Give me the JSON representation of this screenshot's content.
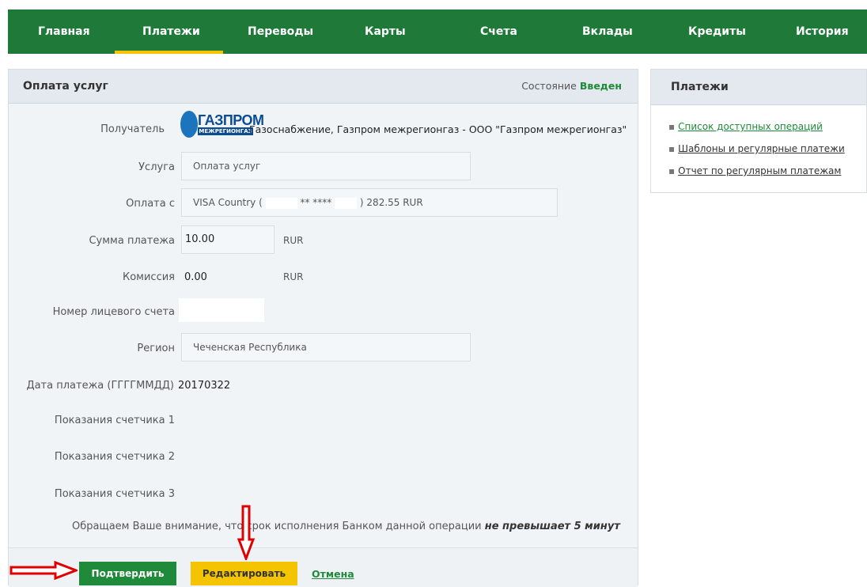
{
  "nav": {
    "items": [
      "Главная",
      "Платежи",
      "Переводы",
      "Карты",
      "Счета",
      "Вклады",
      "Кредиты",
      "История"
    ],
    "active": "Платежи"
  },
  "panel": {
    "title": "Оплата услуг",
    "status_label": "Состояние",
    "status_value": "Введен"
  },
  "form": {
    "recipient_label": "Получатель",
    "recipient_logo_text": "ГАЗПРОМ",
    "recipient_logo_sub": "МЕЖРЕГИОНГАЗ",
    "recipient_value": "Газоснабжение, Газпром межрегионгаз - ООО \"Газпром межрегионгаз\"",
    "service_label": "Услуга",
    "service_value": "Оплата услуг",
    "pay_from_label": "Оплата с",
    "pay_from_prefix": "VISA Country (",
    "pay_from_masked": "** ****",
    "pay_from_suffix": ") 282.55 RUR",
    "amount_label": "Сумма платежа",
    "amount_value": "10.00",
    "amount_currency": "RUR",
    "commission_label": "Комиссия",
    "commission_value": "0.00",
    "commission_currency": "RUR",
    "account_label": "Номер лицевого счета",
    "region_label": "Регион",
    "region_value": "Чеченская Республика",
    "date_label": "Дата платежа (ГГГГММДД)",
    "date_value": "20170322",
    "meter1_label": "Показания счетчика 1",
    "meter2_label": "Показания счетчика 2",
    "meter3_label": "Показания счетчика 3"
  },
  "notice": {
    "text": "Обращаем Ваше внимание, что срок исполнения Банком данной операции ",
    "emphasis": "не превышает 5 минут"
  },
  "actions": {
    "confirm": "Подтвердить",
    "edit": "Редактировать",
    "cancel": "Отмена"
  },
  "side": {
    "title": "Платежи",
    "links": [
      "Список доступных операций",
      "Шаблоны и регулярные платежи",
      "Отчет по регулярным платежам"
    ]
  },
  "colors": {
    "brand_green": "#1f7a3a",
    "accent_yellow": "#f5c400",
    "arrow_red": "#e00000"
  }
}
